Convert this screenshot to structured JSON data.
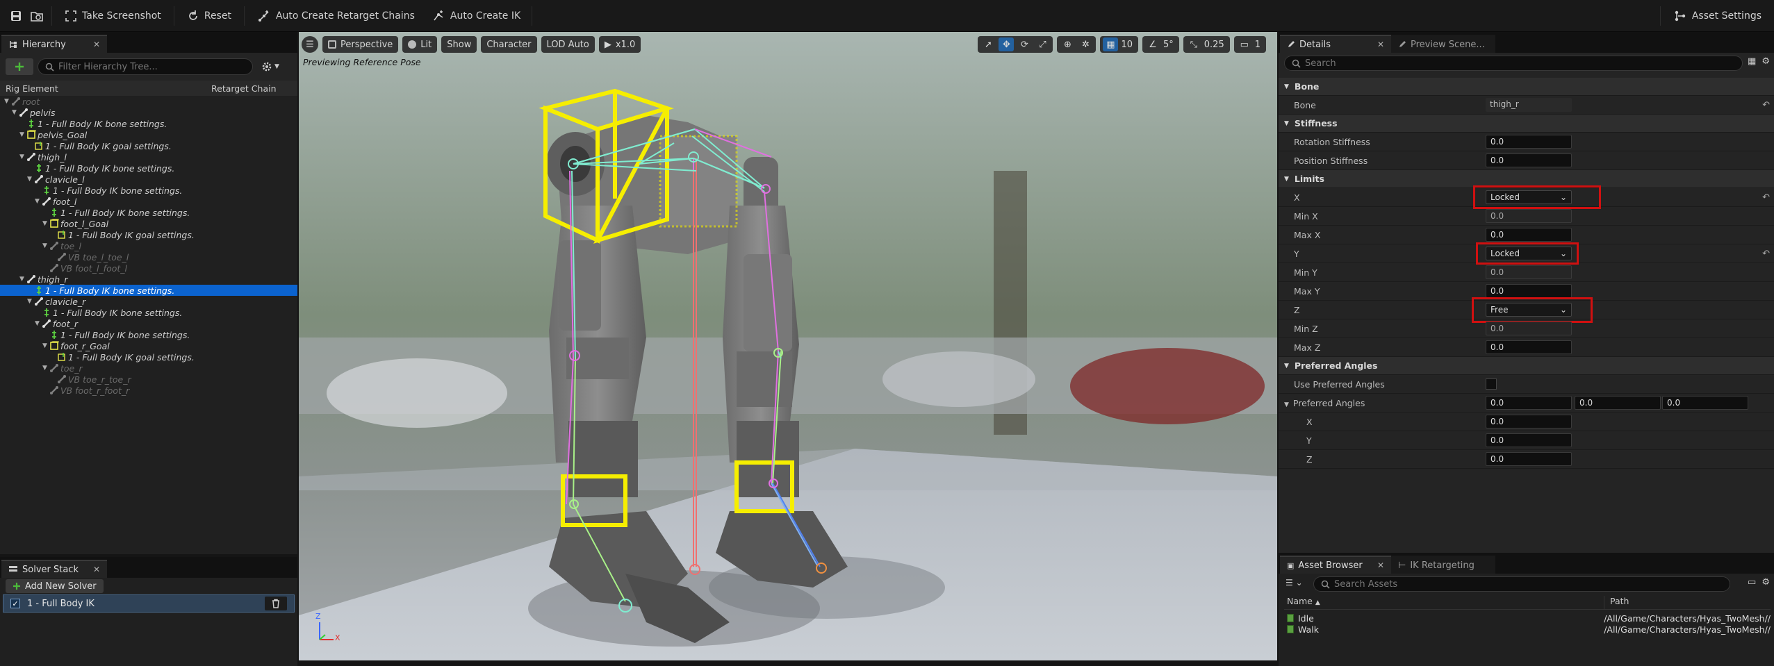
{
  "toolbar": {
    "take_screenshot": "Take Screenshot",
    "reset": "Reset",
    "auto_retarget": "Auto Create Retarget Chains",
    "auto_ik": "Auto Create IK",
    "asset_settings": "Asset Settings"
  },
  "hierarchy": {
    "tab_label": "Hierarchy",
    "search_placeholder": "Filter Hierarchy Tree...",
    "col_rig": "Rig Element",
    "col_chain": "Retarget Chain",
    "rows": [
      {
        "label": "root",
        "type": "bone",
        "depth": 0,
        "dim": true,
        "arrow": true
      },
      {
        "label": "pelvis",
        "type": "bone",
        "depth": 1,
        "arrow": true
      },
      {
        "label": "1 - Full Body IK bone settings.",
        "type": "setting",
        "depth": 2
      },
      {
        "label": "pelvis_Goal",
        "type": "goal",
        "depth": 2,
        "arrow": true
      },
      {
        "label": "1 - Full Body IK goal settings.",
        "type": "goalsetting",
        "depth": 3
      },
      {
        "label": "thigh_l",
        "type": "bone",
        "depth": 2,
        "arrow": true
      },
      {
        "label": "1 - Full Body IK bone settings.",
        "type": "setting",
        "depth": 3
      },
      {
        "label": "clavicle_l",
        "type": "bone",
        "depth": 3,
        "arrow": true
      },
      {
        "label": "1 - Full Body IK bone settings.",
        "type": "setting",
        "depth": 4
      },
      {
        "label": "foot_l",
        "type": "bone",
        "depth": 4,
        "arrow": true
      },
      {
        "label": "1 - Full Body IK bone settings.",
        "type": "setting",
        "depth": 5
      },
      {
        "label": "foot_l_Goal",
        "type": "goal",
        "depth": 5,
        "arrow": true
      },
      {
        "label": "1 - Full Body IK goal settings.",
        "type": "goalsetting",
        "depth": 6
      },
      {
        "label": "toe_l",
        "type": "bone",
        "depth": 5,
        "dim": true,
        "arrow": true
      },
      {
        "label": "VB toe_l_toe_l",
        "type": "bone",
        "depth": 6,
        "dim": true
      },
      {
        "label": "VB foot_l_foot_l",
        "type": "bone",
        "depth": 5,
        "dim": true
      },
      {
        "label": "thigh_r",
        "type": "bone",
        "depth": 2,
        "arrow": true
      },
      {
        "label": "1 - Full Body IK bone settings.",
        "type": "setting",
        "depth": 3,
        "selected": true
      },
      {
        "label": "clavicle_r",
        "type": "bone",
        "depth": 3,
        "arrow": true
      },
      {
        "label": "1 - Full Body IK bone settings.",
        "type": "setting",
        "depth": 4
      },
      {
        "label": "foot_r",
        "type": "bone",
        "depth": 4,
        "arrow": true
      },
      {
        "label": "1 - Full Body IK bone settings.",
        "type": "setting",
        "depth": 5
      },
      {
        "label": "foot_r_Goal",
        "type": "goal",
        "depth": 5,
        "arrow": true
      },
      {
        "label": "1 - Full Body IK goal settings.",
        "type": "goalsetting",
        "depth": 6
      },
      {
        "label": "toe_r",
        "type": "bone",
        "depth": 5,
        "dim": true,
        "arrow": true
      },
      {
        "label": "VB toe_r_toe_r",
        "type": "bone",
        "depth": 6,
        "dim": true
      },
      {
        "label": "VB foot_r_foot_r",
        "type": "bone",
        "depth": 5,
        "dim": true
      }
    ]
  },
  "solver": {
    "tab_label": "Solver Stack",
    "add_label": "Add New Solver",
    "item_label": "1 - Full Body IK"
  },
  "viewport": {
    "perspective": "Perspective",
    "lit": "Lit",
    "show": "Show",
    "character": "Character",
    "lod": "LOD Auto",
    "speed": "x1.0",
    "grid_value": "10",
    "angle_value": "5°",
    "scale_value": "0.25",
    "cam_value": "1",
    "preview_text": "Previewing Reference Pose"
  },
  "details": {
    "tab_details": "Details",
    "tab_preview": "Preview Scene...",
    "search_placeholder": "Search",
    "cat_bone": "Bone",
    "bone_label": "Bone",
    "bone_value": "thigh_r",
    "cat_stiffness": "Stiffness",
    "rot_stiff": "Rotation Stiffness",
    "rot_stiff_v": "0.0",
    "pos_stiff": "Position Stiffness",
    "pos_stiff_v": "0.0",
    "cat_limits": "Limits",
    "x": "X",
    "x_v": "Locked",
    "minx": "Min X",
    "minx_v": "0.0",
    "maxx": "Max X",
    "maxx_v": "0.0",
    "y": "Y",
    "y_v": "Locked",
    "miny": "Min Y",
    "miny_v": "0.0",
    "maxy": "Max Y",
    "maxy_v": "0.0",
    "z": "Z",
    "z_v": "Free",
    "minz": "Min Z",
    "minz_v": "0.0",
    "maxz": "Max Z",
    "maxz_v": "0.0",
    "cat_pref": "Preferred Angles",
    "use_pref": "Use Preferred Angles",
    "pref": "Preferred Angles",
    "pref_v1": "0.0",
    "pref_v2": "0.0",
    "pref_v3": "0.0",
    "px": "X",
    "px_v": "0.0",
    "py": "Y",
    "py_v": "0.0",
    "pz": "Z",
    "pz_v": "0.0"
  },
  "assets": {
    "tab_browser": "Asset Browser",
    "tab_retarget": "IK Retargeting",
    "search_placeholder": "Search Assets",
    "col_name": "Name",
    "col_path": "Path",
    "rows": [
      {
        "name": "Idle",
        "path": "/All/Game/Characters/Hyas_TwoMesh//"
      },
      {
        "name": "Walk",
        "path": "/All/Game/Characters/Hyas_TwoMesh//"
      }
    ]
  }
}
